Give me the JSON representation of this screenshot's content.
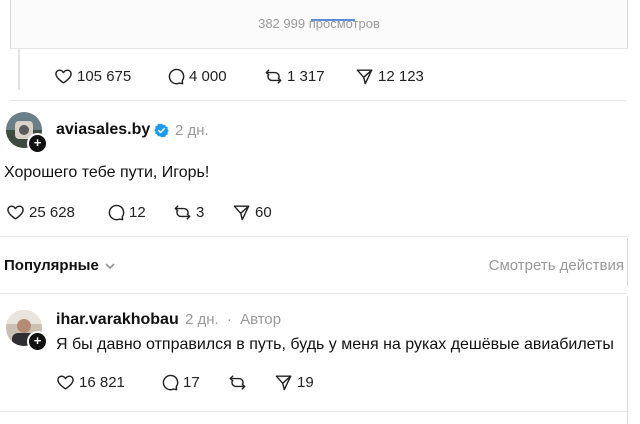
{
  "top_post": {
    "views": "382 999 просмотров",
    "stats": {
      "likes": "105 675",
      "replies": "4 000",
      "reposts": "1 317",
      "shares": "12 123"
    }
  },
  "reply_1": {
    "username": "aviasales.by",
    "time": "2 дн.",
    "text": "Хорошего тебе пути, Игорь!",
    "stats": {
      "likes": "25 628",
      "replies": "12",
      "reposts": "3",
      "shares": "60"
    }
  },
  "sort": {
    "label": "Популярные",
    "see_actions": "Смотреть действия"
  },
  "reply_2": {
    "username": "ihar.varakhobau",
    "time": "2 дн.",
    "separator": "·",
    "author_tag": "Автор",
    "text": "Я бы давно отправился в путь, будь у меня на руках дешёвые авиабилеты",
    "stats": {
      "likes": "16 821",
      "replies": "17",
      "reposts": "",
      "shares": "19"
    }
  },
  "colors": {
    "verified": "#1d9bf0",
    "text": "#111111",
    "muted": "#9a9a9a"
  },
  "icons": [
    "heart-icon",
    "comment-icon",
    "repost-icon",
    "send-icon",
    "verified-icon",
    "follow-plus-icon",
    "chevron-down-icon"
  ]
}
